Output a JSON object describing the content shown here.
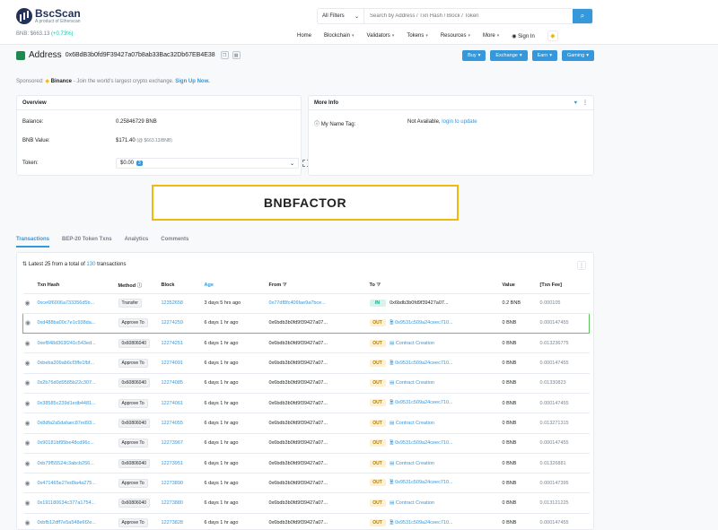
{
  "brand": {
    "name": "BscScan",
    "sub": "A product of Etherscan"
  },
  "price": {
    "label": "BNB: $663.13",
    "change": "(+0.73%)"
  },
  "search": {
    "filter": "All Filters",
    "placeholder": "Search by Address / Txn Hash / Block / Token"
  },
  "nav": {
    "items": [
      "Home",
      "Blockchain",
      "Validators",
      "Tokens",
      "Resources",
      "More"
    ],
    "signin": "Sign In"
  },
  "address": {
    "label": "Address",
    "value": "0x6BdB3b0fd9F39427a07b8ab33Bac32Db67EB4E38"
  },
  "top_buttons": [
    "Buy",
    "Exchange",
    "Earn",
    "Gaming"
  ],
  "sponsored": {
    "prefix": "Sponsored:",
    "name": "Binance",
    "text": "- Join the world's largest crypto exchange.",
    "cta": "Sign Up Now."
  },
  "overview": {
    "title": "Overview",
    "balance_label": "Balance:",
    "balance_value": "0.25846729 BNB",
    "value_label": "BNB Value:",
    "value_amount": "$171.40",
    "value_sub": "(@ $663.13/BNB)",
    "token_label": "Token:",
    "token_value": "$0.00",
    "token_count": "3"
  },
  "more_info": {
    "title": "More Info",
    "tag_label": "My Name Tag:",
    "tag_value": "Not Available,",
    "tag_link": "login to update"
  },
  "highlight_text": "BNBFACTOR",
  "tabs": [
    "Transactions",
    "BEP-20 Token Txns",
    "Analytics",
    "Comments"
  ],
  "txn_summary": {
    "prefix": "Latest 25 from a total of",
    "count": "130",
    "suffix": "transactions"
  },
  "columns": [
    "Txn Hash",
    "Method",
    "Block",
    "Age",
    "From",
    "To",
    "Value",
    "[Txn Fee]"
  ],
  "rows": [
    {
      "hash": "0xce6f6006a733356d5b...",
      "method": "Transfer",
      "block": "12352658",
      "age": "3 days 5 hrs ago",
      "from": "0x77df8fc406fae9a7bce...",
      "from_link": true,
      "dir": "IN",
      "to": "0x6bdb3b0fd9f39427a07...",
      "to_link": false,
      "to_icon": "",
      "value": "0.2 BNB",
      "fee": "0.000105"
    },
    {
      "hash": "0xd488ba00c7e1c938da...",
      "method": "Approve To",
      "block": "12274259",
      "age": "6 days 1 hr ago",
      "from": "0x6bdb3b0fd9f39427a07...",
      "from_link": false,
      "dir": "OUT",
      "to": "0x9531c509a24ceec710...",
      "to_link": true,
      "to_icon": "contract",
      "value": "0 BNB",
      "fee": "0.000147455"
    },
    {
      "hash": "0xef848d363f241c543ed...",
      "method": "0x60806040",
      "block": "12274251",
      "age": "6 days 1 hr ago",
      "from": "0x6bdb3b0fd9f39427a07...",
      "from_link": false,
      "dir": "OUT",
      "to": "Contract Creation",
      "to_link": true,
      "to_icon": "creation",
      "value": "0 BNB",
      "fee": "0.013236775"
    },
    {
      "hash": "0xbeba309ab6cf3ffe1fbf...",
      "method": "Approve To",
      "block": "12274091",
      "age": "6 days 1 hr ago",
      "from": "0x6bdb3b0fd9f39427a07...",
      "from_link": false,
      "dir": "OUT",
      "to": "0x9531c509a24ceec710...",
      "to_link": true,
      "to_icon": "contract",
      "value": "0 BNB",
      "fee": "0.000147455"
    },
    {
      "hash": "0x2b76d0d9585b22c307...",
      "method": "0x60806040",
      "block": "12274085",
      "age": "6 days 1 hr ago",
      "from": "0x6bdb3b0fd9f39427a07...",
      "from_link": false,
      "dir": "OUT",
      "to": "Contract Creation",
      "to_link": true,
      "to_icon": "creation",
      "value": "0 BNB",
      "fee": "0.01330823"
    },
    {
      "hash": "0x38585c239d1edb4481...",
      "method": "Approve To",
      "block": "12274061",
      "age": "6 days 1 hr ago",
      "from": "0x6bdb3b0fd9f39427a07...",
      "from_link": false,
      "dir": "OUT",
      "to": "0x9531c509a24ceec710...",
      "to_link": true,
      "to_icon": "contract",
      "value": "0 BNB",
      "fee": "0.000147455"
    },
    {
      "hash": "0x8dfa2a5dafaec87ed93...",
      "method": "0x60806040",
      "block": "12274055",
      "age": "6 days 1 hr ago",
      "from": "0x6bdb3b0fd9f39427a07...",
      "from_link": false,
      "dir": "OUT",
      "to": "Contract Creation",
      "to_link": true,
      "to_icon": "creation",
      "value": "0 BNB",
      "fee": "0.013271315"
    },
    {
      "hash": "0x90181bf95be48cd96c...",
      "method": "Approve To",
      "block": "12273967",
      "age": "6 days 1 hr ago",
      "from": "0x6bdb3b0fd9f39427a07...",
      "from_link": false,
      "dir": "OUT",
      "to": "0x9531c509a24ceec710...",
      "to_link": true,
      "to_icon": "contract",
      "value": "0 BNB",
      "fee": "0.000147455"
    },
    {
      "hash": "0xb79f55524c3abcb256...",
      "method": "0x60806040",
      "block": "12273951",
      "age": "6 days 1 hr ago",
      "from": "0x6bdb3b0fd9f39427a07...",
      "from_link": false,
      "dir": "OUT",
      "to": "Contract Creation",
      "to_link": true,
      "to_icon": "creation",
      "value": "0 BNB",
      "fee": "0.01326881"
    },
    {
      "hash": "0x471465e27ed9a4a275...",
      "method": "Approve To",
      "block": "12273890",
      "age": "6 days 1 hr ago",
      "from": "0x6bdb3b0fd9f39427a07...",
      "from_link": false,
      "dir": "OUT",
      "to": "0x9531c509a24ceec710...",
      "to_link": true,
      "to_icon": "contract",
      "value": "0 BNB",
      "fee": "0.000147395"
    },
    {
      "hash": "0x191180634c377a1754...",
      "method": "0x60806040",
      "block": "12273880",
      "age": "6 days 1 hr ago",
      "from": "0x6bdb3b0fd9f39427a07...",
      "from_link": false,
      "dir": "OUT",
      "to": "Contract Creation",
      "to_link": true,
      "to_icon": "creation",
      "value": "0 BNB",
      "fee": "0.013121225"
    },
    {
      "hash": "0xbfb12dff7e5a548e6f2e...",
      "method": "Approve To",
      "block": "12273828",
      "age": "6 days 1 hr ago",
      "from": "0x6bdb3b0fd9f39427a07...",
      "from_link": false,
      "dir": "OUT",
      "to": "0x9531c509a24ceec710...",
      "to_link": true,
      "to_icon": "contract",
      "value": "0 BNB",
      "fee": "0.000147455"
    }
  ],
  "highlighted_row": 1,
  "colors": {
    "accent": "#3498db",
    "brand": "#21325b",
    "bnb": "#f0b90b",
    "highlight_border": "#5cc75c",
    "out": "#b47d00",
    "in": "#00a686"
  }
}
